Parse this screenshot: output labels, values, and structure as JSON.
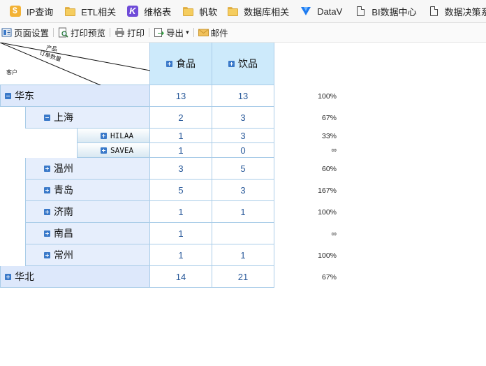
{
  "bookmarks": [
    {
      "label": "IP查询",
      "icon": "ip-app-icon"
    },
    {
      "label": "ETL相关",
      "icon": "folder-icon"
    },
    {
      "label": "维格表",
      "icon": "vika-app-icon"
    },
    {
      "label": "帆软",
      "icon": "folder-icon"
    },
    {
      "label": "数据库相关",
      "icon": "folder-icon"
    },
    {
      "label": "DataV",
      "icon": "datav-icon"
    },
    {
      "label": "BI数据中心",
      "icon": "file-icon"
    },
    {
      "label": "数据决策系统",
      "icon": "file-icon"
    }
  ],
  "toolbar": {
    "page_setup": "页面设置",
    "print_preview": "打印预览",
    "print": "打印",
    "export": "导出",
    "export_caret": "▾",
    "mail": "邮件"
  },
  "report": {
    "corner": {
      "product": "产品",
      "order_qty": "订单数量",
      "customer": "客户"
    },
    "columns": [
      "食品",
      "饮品"
    ],
    "rows": [
      {
        "name": "华东",
        "level": 0,
        "toggle": "minus",
        "food": "13",
        "drink": "13",
        "ratio": "100%"
      },
      {
        "name": "上海",
        "level": 1,
        "toggle": "minus",
        "food": "2",
        "drink": "3",
        "ratio": "67%"
      },
      {
        "name": "HILAA",
        "level": 2,
        "toggle": "plus",
        "food": "1",
        "drink": "3",
        "ratio": "33%"
      },
      {
        "name": "SAVEA",
        "level": 2,
        "toggle": "plus",
        "food": "1",
        "drink": "0",
        "ratio": "∞"
      },
      {
        "name": "温州",
        "level": 1,
        "toggle": "plus",
        "food": "3",
        "drink": "5",
        "ratio": "60%"
      },
      {
        "name": "青岛",
        "level": 1,
        "toggle": "plus",
        "food": "5",
        "drink": "3",
        "ratio": "167%"
      },
      {
        "name": "济南",
        "level": 1,
        "toggle": "plus",
        "food": "1",
        "drink": "1",
        "ratio": "100%"
      },
      {
        "name": "南昌",
        "level": 1,
        "toggle": "plus",
        "food": "1",
        "drink": "",
        "ratio": "∞"
      },
      {
        "name": "常州",
        "level": 1,
        "toggle": "plus",
        "food": "1",
        "drink": "1",
        "ratio": "100%"
      },
      {
        "name": "华北",
        "level": 0,
        "toggle": "plus",
        "food": "14",
        "drink": "21",
        "ratio": "67%"
      }
    ]
  }
}
